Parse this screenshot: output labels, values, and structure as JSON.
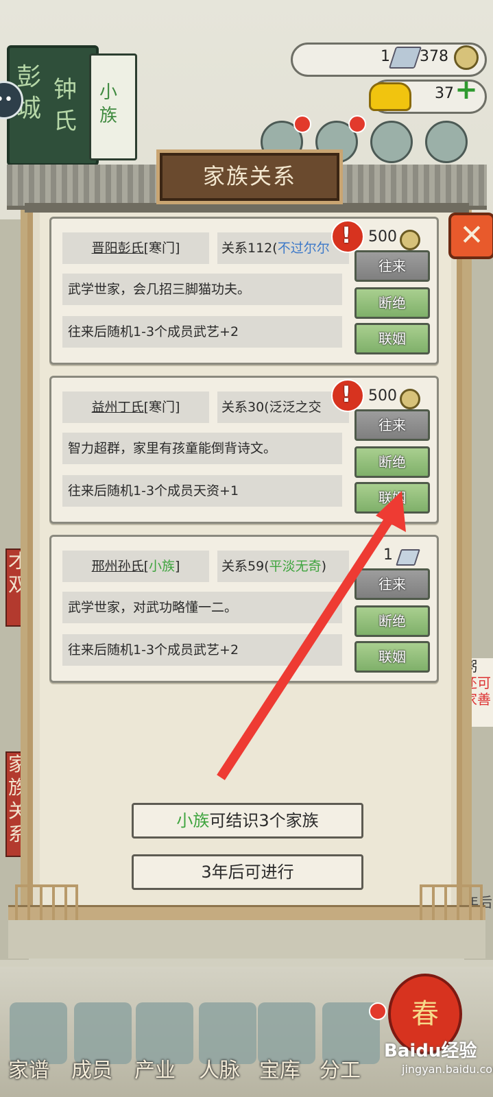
{
  "header": {
    "family_book_title_1": "彭城",
    "family_book_title_2": "钟氏",
    "family_book_rank": "小族",
    "chat_icon": "chat-bubble-icon",
    "silver_count": "1",
    "coin_count": "378",
    "gold_count": "37"
  },
  "panel": {
    "title": "家族关系",
    "close_icon": "close-x-icon"
  },
  "clans": [
    {
      "name": "晋阳彭氏",
      "rank": "寒门",
      "rank_color": "#2a2a2a",
      "relation_label": "关系112(",
      "relation_desc": "不过尔尔",
      "relation_color": "#3c78c8",
      "cost": "500",
      "cost_type": "coin",
      "has_alert": true,
      "desc": "武学世家，会几招三脚猫功夫。",
      "effect": "往来后随机1-3个成员武艺+2",
      "btn_visit": "往来",
      "btn_break": "断绝",
      "btn_marry": "联姻"
    },
    {
      "name": "益州丁氏",
      "rank": "寒门",
      "rank_color": "#2a2a2a",
      "relation_label": "关系30(",
      "relation_desc": "泛泛之交",
      "relation_color": "#2a2a2a",
      "cost": "500",
      "cost_type": "coin",
      "has_alert": true,
      "desc": "智力超群，家里有孩童能倒背诗文。",
      "effect": "往来后随机1-3个成员天资+1",
      "btn_visit": "往来",
      "btn_break": "断绝",
      "btn_marry": "联姻"
    },
    {
      "name": "邢州孙氏",
      "rank": "小族",
      "rank_color": "#3ea43e",
      "relation_label": "关系59(",
      "relation_desc": "平淡无奇",
      "relation_close": ")",
      "relation_color": "#3ea43e",
      "cost": "1",
      "cost_type": "silver",
      "has_alert": false,
      "desc": "武学世家，对武功略懂一二。",
      "effect": "往来后随机1-3个成员武艺+2",
      "btn_visit": "往来",
      "btn_break": "断绝",
      "btn_marry": "联姻"
    }
  ],
  "footer_info": {
    "rank_word": "小族",
    "rank_color": "#3ea43e",
    "capacity_text": "可结识3个家族",
    "cooldown_text": "3年后可进行"
  },
  "side_cards": {
    "left_top": "才双",
    "left_bottom": "家族关系",
    "right_text_1": "粥",
    "right_text_2": "还可",
    "right_text_3": "家善",
    "right_text_4": "年后"
  },
  "nav": {
    "items": [
      {
        "label": "家谱",
        "icon": "genealogy-book-icon"
      },
      {
        "label": "成员",
        "icon": "member-portrait-icon"
      },
      {
        "label": "产业",
        "icon": "industry-building-icon"
      },
      {
        "label": "人脉",
        "icon": "network-icon"
      },
      {
        "label": "宝库",
        "icon": "treasure-chest-icon"
      },
      {
        "label": "分工",
        "icon": "scroll-icon"
      }
    ],
    "spring_badge": "春"
  },
  "watermark": {
    "brand": "Baidu经验",
    "url": "jingyan.baidu.com"
  },
  "colors": {
    "accent_red": "#ee3b33",
    "button_green": "#8fbf76",
    "button_gray": "#8c8c8c"
  }
}
